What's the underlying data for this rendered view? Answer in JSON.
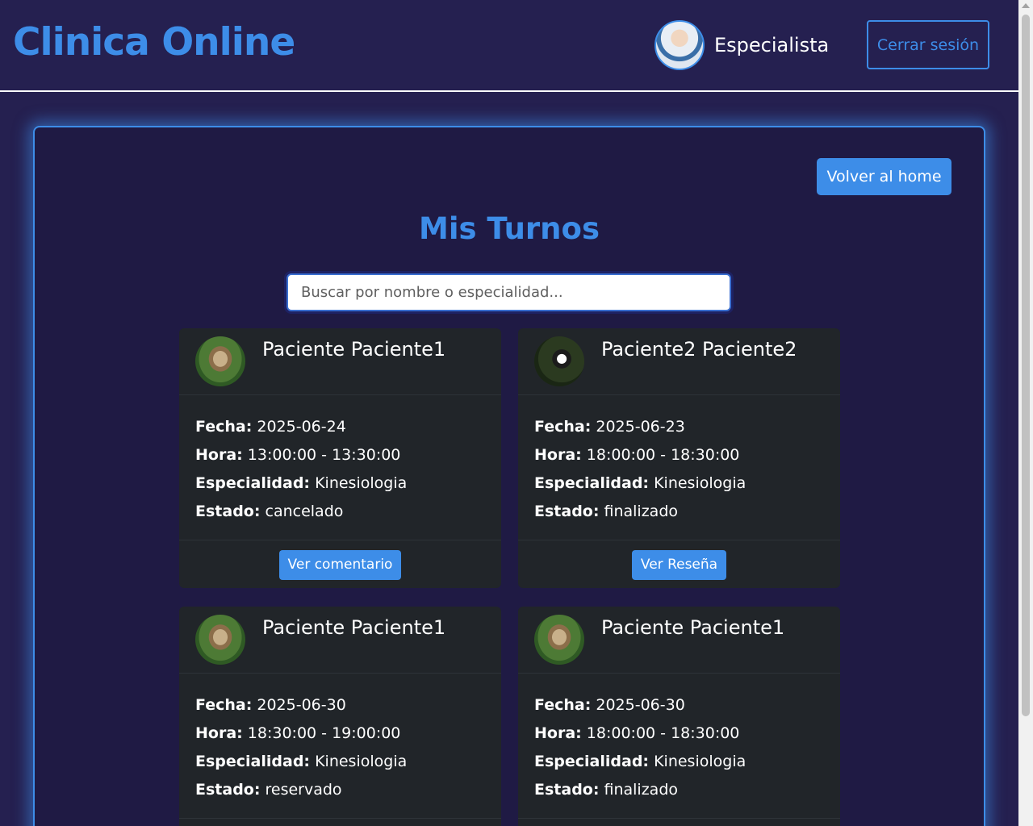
{
  "navbar": {
    "brand": "Clinica Online",
    "user_role": "Especialista",
    "logout_label": "Cerrar sesión"
  },
  "main": {
    "home_label": "Volver al home",
    "title": "Mis Turnos",
    "search_placeholder": "Buscar por nombre o especialidad..."
  },
  "labels": {
    "fecha": "Fecha:",
    "hora": "Hora:",
    "especialidad": "Especialidad:",
    "estado": "Estado:"
  },
  "turnos": [
    {
      "paciente": "Paciente Paciente1",
      "avatar": "meerkat-photo",
      "fecha": "2025-06-24",
      "hora": "13:00:00 - 13:30:00",
      "especialidad": "Kinesiologia",
      "estado": "cancelado",
      "action": "Ver comentario"
    },
    {
      "paciente": "Paciente2 Paciente2",
      "avatar": "bird-photo",
      "fecha": "2025-06-23",
      "hora": "18:00:00 - 18:30:00",
      "especialidad": "Kinesiologia",
      "estado": "finalizado",
      "action": "Ver Reseña"
    },
    {
      "paciente": "Paciente Paciente1",
      "avatar": "meerkat-photo",
      "fecha": "2025-06-30",
      "hora": "18:30:00 - 19:00:00",
      "especialidad": "Kinesiologia",
      "estado": "reservado",
      "action": ""
    },
    {
      "paciente": "Paciente Paciente1",
      "avatar": "meerkat-photo",
      "fecha": "2025-06-30",
      "hora": "18:00:00 - 18:30:00",
      "especialidad": "Kinesiologia",
      "estado": "finalizado",
      "action": ""
    }
  ],
  "colors": {
    "background": "#252050",
    "accent": "#3d8de8",
    "card": "#212529",
    "panel": "#1f1a44"
  }
}
